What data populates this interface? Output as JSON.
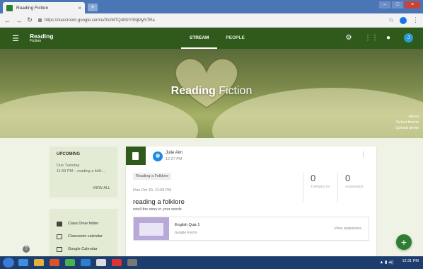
{
  "browser": {
    "tab_title": "Reading Fiction",
    "new_tab": "+",
    "url": "https://classroom.google.com/u/0/c/MTQ4MzY3NjMyNTRa",
    "profile_initial": "J"
  },
  "header": {
    "class_name": "Reading",
    "class_section": "Fiction",
    "tabs": [
      {
        "label": "STREAM",
        "active": true
      },
      {
        "label": "PEOPLE",
        "active": false
      }
    ],
    "avatar_initial": "J"
  },
  "banner": {
    "title_bold": "Reading",
    "title_light": "Fiction",
    "links": [
      "About",
      "Select theme",
      "Upload photo"
    ]
  },
  "upcoming": {
    "heading": "UPCOMING",
    "due_label": "Due Tuesday",
    "item": "11:59 PM – reading a folkl...",
    "view_all": "VIEW ALL"
  },
  "sidebar_links": [
    {
      "label": "Class Drive folder",
      "icon": "folder-icon"
    },
    {
      "label": "Classroom calendar",
      "icon": "calendar-icon"
    },
    {
      "label": "Google Calendar",
      "icon": "external-link-icon"
    }
  ],
  "post": {
    "author": "Julie Aim",
    "time": "12:27 PM",
    "topic": "Reading a Folklore",
    "due": "Due Oct 30, 11:59 PM",
    "title": "reading a folklore",
    "instructions": "retell the story in your words",
    "turned_in": {
      "value": "0",
      "label": "TURNED IN"
    },
    "assigned": {
      "value": "0",
      "label": "ASSIGNED"
    },
    "attachment": {
      "name": "English Quiz 1",
      "type": "Google Forms",
      "action": "View responses"
    }
  },
  "fab": "+",
  "taskbar": {
    "clock": "12:31 PM"
  },
  "colors": {
    "header_green": "#2f5a1c",
    "page_bg": "#eef3e6",
    "fab_green": "#2e7d32",
    "taskbar": "#1c3d6e"
  }
}
